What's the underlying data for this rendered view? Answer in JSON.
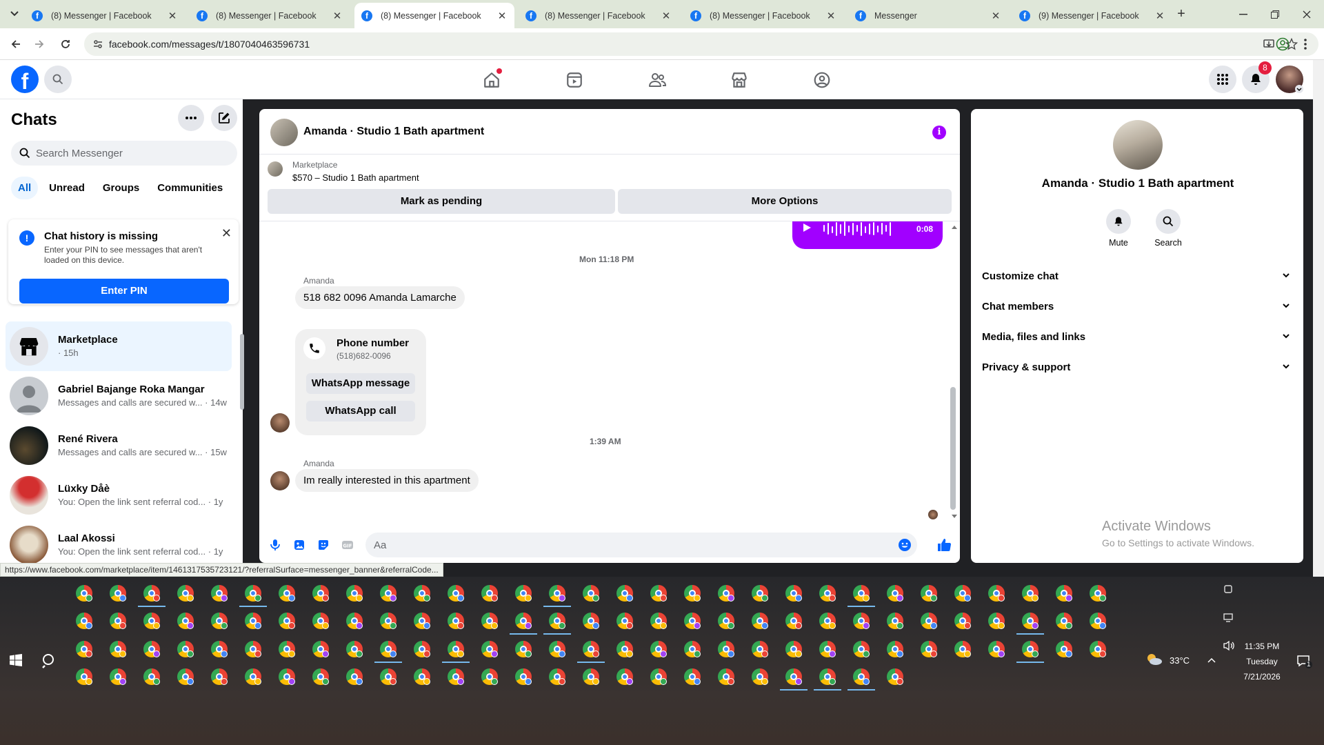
{
  "browser": {
    "tabs": [
      {
        "title": "(8) Messenger | Facebook",
        "active": false
      },
      {
        "title": "(8) Messenger | Facebook",
        "active": false
      },
      {
        "title": "(8) Messenger | Facebook",
        "active": true
      },
      {
        "title": "(8) Messenger | Facebook",
        "active": false
      },
      {
        "title": "(8) Messenger | Facebook",
        "active": false
      },
      {
        "title": "Messenger",
        "active": false
      },
      {
        "title": "(9) Messenger | Facebook",
        "active": false
      }
    ],
    "url": "facebook.com/messages/t/1807040463596731",
    "status_url": "https://www.facebook.com/marketplace/item/1461317535723121/?referralSurface=messenger_banner&referralCode..."
  },
  "header": {
    "logo": "f",
    "notification_count": "8"
  },
  "sidebar": {
    "title": "Chats",
    "search_placeholder": "Search Messenger",
    "filters": [
      "All",
      "Unread",
      "Groups",
      "Communities"
    ],
    "notice": {
      "title": "Chat history is missing",
      "body": "Enter your PIN to see messages that aren't loaded on this device.",
      "button": "Enter PIN"
    },
    "chats": [
      {
        "name": "Marketplace",
        "preview": "· 15h"
      },
      {
        "name": "Gabriel Bajange Roka Mangar",
        "preview": "Messages and calls are secured w... · 14w"
      },
      {
        "name": "René Rivera",
        "preview": "Messages and calls are secured w... · 15w"
      },
      {
        "name": "Lüxky Dåè",
        "preview": "You: Open the link sent referral cod... · 1y"
      },
      {
        "name": "Laal Akossi",
        "preview": "You: Open the link sent referral cod... · 1y"
      }
    ]
  },
  "conversation": {
    "title": "Amanda · Studio 1 Bath apartment",
    "info_icon": "i",
    "marketplace_label": "Marketplace",
    "listing": "$570 – Studio 1 Bath apartment",
    "mark_pending": "Mark as pending",
    "more_options": "More Options",
    "audio_duration": "0:08",
    "timestamp_1": "Mon 11:18 PM",
    "sender_1": "Amanda",
    "message_1": "518 682 0096  Amanda Lamarche",
    "phone_card": {
      "title": "Phone number",
      "number": "(518)682-0096",
      "whatsapp_message": "WhatsApp message",
      "whatsapp_call": "WhatsApp call"
    },
    "timestamp_2": "1:39 AM",
    "sender_2": "Amanda",
    "message_2": "Im really interested in this apartment",
    "composer_placeholder": "Aa"
  },
  "details": {
    "name": "Amanda · Studio 1 Bath apartment",
    "actions": [
      "Mute",
      "Search"
    ],
    "sections": [
      "Customize chat",
      "Chat members",
      "Media, files and links",
      "Privacy & support"
    ]
  },
  "watermark": {
    "line1": "Activate Windows",
    "line2": "Go to Settings to activate Windows."
  },
  "taskbar": {
    "temperature": "33°C",
    "time": "11:35 PM",
    "day": "Tuesday",
    "date": "7/21/2026",
    "notification_count": "1"
  },
  "colors": {
    "facebook_blue": "#0866ff",
    "messenger_purple": "#a100ff",
    "tab_strip": "#dfe7d9"
  }
}
